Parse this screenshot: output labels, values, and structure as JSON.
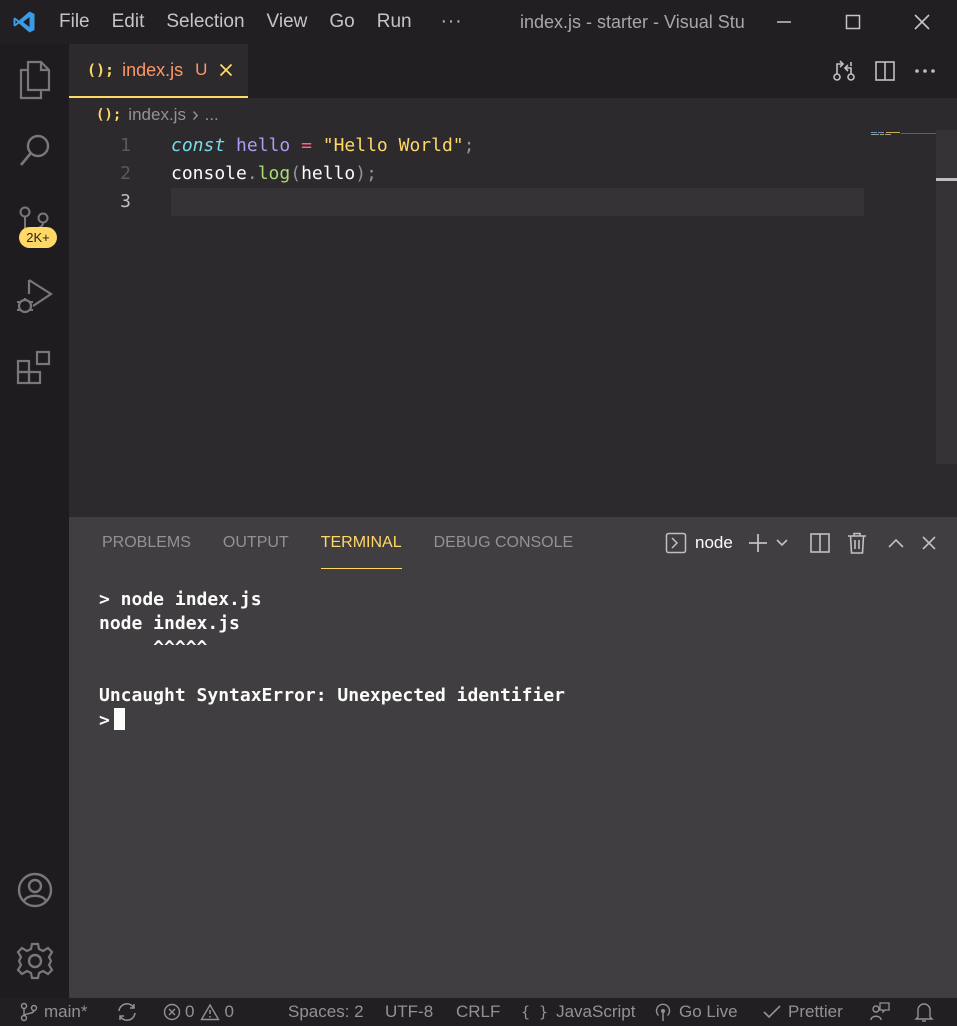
{
  "titlebar": {
    "menu": [
      "File",
      "Edit",
      "Selection",
      "View",
      "Go",
      "Run"
    ],
    "more": "···",
    "title": "index.js - starter - Visual Studio Code"
  },
  "activity": {
    "items": [
      "explorer-icon",
      "search-icon",
      "source-control-icon",
      "run-debug-icon",
      "extensions-icon"
    ],
    "source_control_badge": "2K+",
    "bottom": [
      "accounts-icon",
      "manage-gear-icon"
    ]
  },
  "tab": {
    "icon": "();",
    "filename": "index.js",
    "status": "U",
    "active_color": "#ffd866"
  },
  "breadcrumb": {
    "icon": "();",
    "file": "index.js",
    "separator": "›",
    "ellipsis": "..."
  },
  "editor": {
    "lines": [
      {
        "number": "1",
        "tokens": [
          "const",
          " ",
          "hello",
          " ",
          "=",
          " ",
          "\"Hello World\"",
          ";"
        ]
      },
      {
        "number": "2",
        "tokens": [
          "console",
          ".",
          "log",
          "(",
          "hello",
          ")",
          ";"
        ]
      },
      {
        "number": "3",
        "tokens": []
      }
    ],
    "current_line": 3
  },
  "panel": {
    "tabs": [
      "PROBLEMS",
      "OUTPUT",
      "TERMINAL",
      "DEBUG CONSOLE"
    ],
    "active_tab": "TERMINAL",
    "terminal_name": "node",
    "terminal_lines": [
      "> node index.js",
      "node index.js",
      "     ^^^^^",
      "",
      "Uncaught SyntaxError: Unexpected identifier",
      ">"
    ]
  },
  "statusbar": {
    "branch": "main*",
    "errors": "0",
    "warnings": "0",
    "spaces": "Spaces: 2",
    "encoding": "UTF-8",
    "eol": "CRLF",
    "language": "JavaScript",
    "language_icon": "{ }",
    "golive": "Go Live",
    "prettier": "Prettier"
  },
  "colors": {
    "accent": "#ffd866",
    "modified": "#fc9867",
    "background": "#2d2a2e"
  }
}
